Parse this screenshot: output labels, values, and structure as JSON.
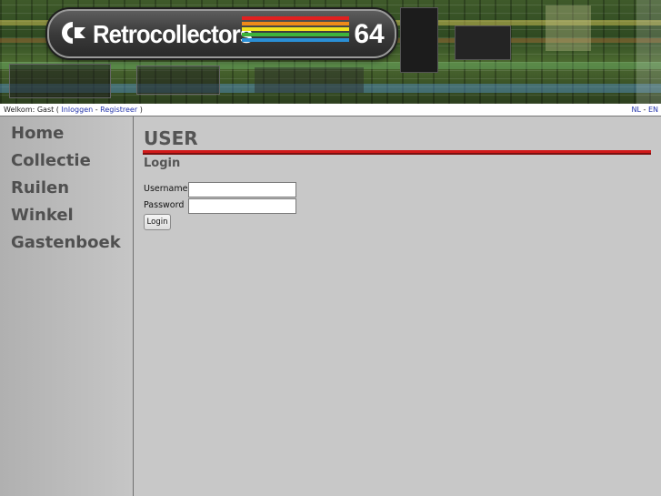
{
  "banner": {
    "logo_text": "Retrocollectors",
    "logo_number": "64",
    "stripe_colors": [
      "#e02020",
      "#f08a1a",
      "#f2e21e",
      "#3cb43c",
      "#2a8fd6"
    ]
  },
  "statusbar": {
    "welcome": "Welkom: Gast (",
    "login_link": "Inloggen",
    "separator": " - ",
    "register_link": "Registreer",
    "close_paren": " )",
    "lang_nl": "NL",
    "lang_sep": " - ",
    "lang_en": "EN"
  },
  "sidebar": {
    "items": [
      {
        "label": "Home"
      },
      {
        "label": "Collectie"
      },
      {
        "label": "Ruilen"
      },
      {
        "label": "Winkel"
      },
      {
        "label": "Gastenboek"
      }
    ]
  },
  "main": {
    "title": "USER",
    "section": "Login",
    "username_label": "Username",
    "username_value": "",
    "password_label": "Password",
    "password_value": "",
    "login_button": "Login"
  },
  "colors": {
    "accent_rule": "#d11a1a",
    "link": "#2233aa"
  }
}
